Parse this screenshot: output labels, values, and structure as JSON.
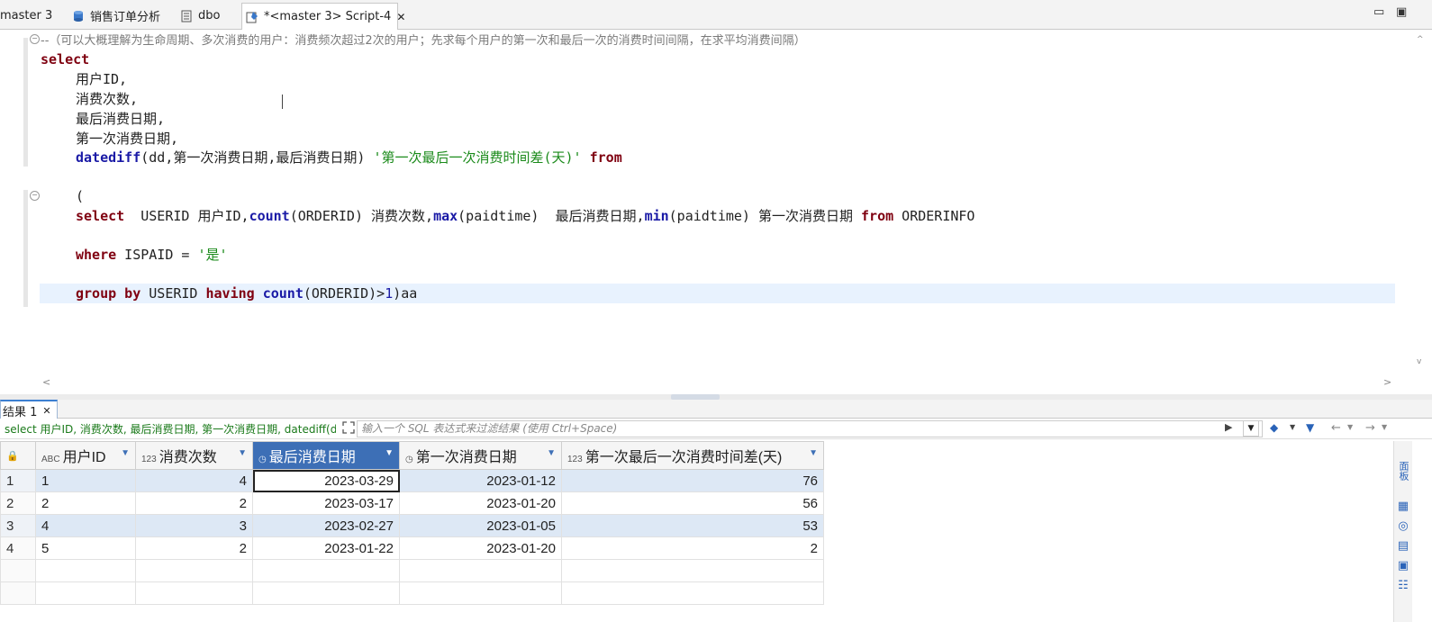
{
  "tabs": [
    {
      "label": "master 3",
      "icon": "",
      "active": false
    },
    {
      "label": "销售订单分析",
      "icon": "database-icon",
      "active": false
    },
    {
      "label": "dbo",
      "icon": "schema-icon",
      "active": false
    },
    {
      "label": "*<master 3> Script-4",
      "icon": "script-icon",
      "active": true
    }
  ],
  "tab_close_glyph": "✕",
  "window_controls": {
    "minimize": "▭",
    "maximize": "▣"
  },
  "editor": {
    "lines": {
      "comment": "--（可以大概理解为生命周期、多次消费的用户：消费频次超过2次的用户；先求每个用户的第一次和最后一次的消费时间间隔，在求平均消费间隔）",
      "select": "select",
      "col1": "用户ID,",
      "col2": "消费次数,",
      "col3": "最后消费日期,",
      "col4": "第一次消费日期,",
      "datediff_fn": "datediff",
      "datediff_args": "(dd,第一次消费日期,最后消费日期)",
      "datediff_alias": "'第一次最后一次消费时间差(天)'",
      "from": "from",
      "paren": "(",
      "sub_select": "select",
      "sub_mid1": "  USERID 用户ID,",
      "count_fn": "count",
      "sub_mid2": "(ORDERID) 消费次数,",
      "max_fn": "max",
      "sub_mid3": "(paidtime)  最后消费日期,",
      "min_fn": "min",
      "sub_mid4": "(paidtime) 第一次消费日期 ",
      "sub_from": "from",
      "sub_table": " ORDERINFO",
      "where": "where",
      "where_cond": " ISPAID = ",
      "where_val": "'是'",
      "group_by": "group by",
      "group_col": " USERID ",
      "having": "having",
      "having_sp": " ",
      "having_fn": "count",
      "having_args": "(ORDERID)>",
      "having_num": "1",
      "having_end": ")aa"
    }
  },
  "results": {
    "tab_label": "结果 1",
    "sql_preview": "select 用户ID, 消费次数, 最后消费日期, 第一次消费日期, datediff(dd",
    "filter_placeholder": "输入一个 SQL 表达式来过滤结果 (使用 Ctrl+Space)",
    "columns": [
      {
        "type": "ABC",
        "label": "用户ID",
        "selected": false
      },
      {
        "type": "123",
        "label": "消费次数",
        "selected": false
      },
      {
        "type": "◷",
        "label": "最后消费日期",
        "selected": true
      },
      {
        "type": "◷",
        "label": "第一次消费日期",
        "selected": false
      },
      {
        "type": "123",
        "label": "第一次最后一次消费时间差(天)",
        "selected": false
      }
    ],
    "rows": [
      {
        "n": "1",
        "cells": [
          "1",
          "4",
          "2023-03-29",
          "2023-01-12",
          "76"
        ]
      },
      {
        "n": "2",
        "cells": [
          "2",
          "2",
          "2023-03-17",
          "2023-01-20",
          "56"
        ]
      },
      {
        "n": "3",
        "cells": [
          "4",
          "3",
          "2023-02-27",
          "2023-01-05",
          "53"
        ]
      },
      {
        "n": "4",
        "cells": [
          "5",
          "2",
          "2023-01-22",
          "2023-01-20",
          "2"
        ]
      }
    ],
    "side_label": "面板"
  }
}
